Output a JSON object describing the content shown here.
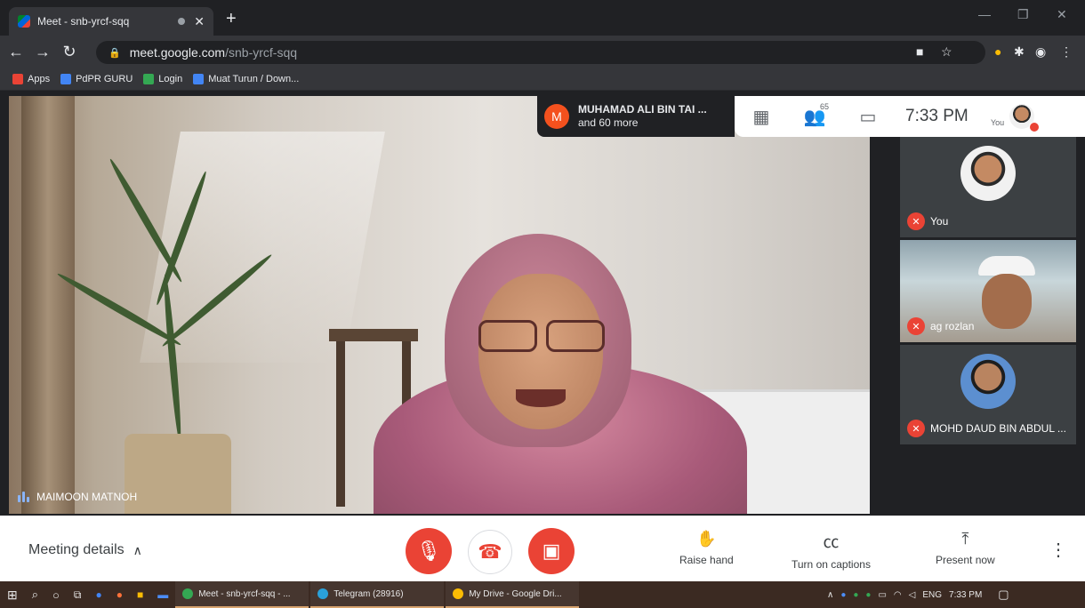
{
  "browser": {
    "tab_title": "Meet - snb-yrcf-sqq",
    "url_host": "meet.google.com",
    "url_path": "/snb-yrcf-sqq",
    "bookmarks": [
      {
        "label": "Apps",
        "color": "#ea4335"
      },
      {
        "label": "PdPR GURU",
        "color": "#4285f4"
      },
      {
        "label": "Login",
        "color": "#34a853"
      },
      {
        "label": "Muat Turun / Down...",
        "color": "#4285f4"
      }
    ]
  },
  "meet": {
    "main_speaker": "MAIMOON MATNOH",
    "presence": {
      "avatar_letter": "M",
      "name": "MUHAMAD ALI BIN TAI ...",
      "subtext": "and 60 more"
    },
    "participants_count": "65",
    "time": "7:33 PM",
    "you_label": "You",
    "tiles": [
      {
        "name": "You"
      },
      {
        "name": "ag rozlan"
      },
      {
        "name": "MOHD DAUD BIN ABDUL ..."
      }
    ],
    "controls": {
      "meeting_details": "Meeting details",
      "raise_hand": "Raise hand",
      "captions": "Turn on captions",
      "present": "Present now"
    },
    "colors": {
      "accent_red": "#ea4335",
      "speaking_blue": "#8ab4f8"
    }
  },
  "taskbar": {
    "apps": [
      {
        "label": "Meet - snb-yrcf-sqq - ...",
        "color": "#34a853"
      },
      {
        "label": "Telegram (28916)",
        "color": "#2aa1da"
      },
      {
        "label": "My Drive - Google Dri...",
        "color": "#fbbc04"
      }
    ],
    "language": "ENG",
    "time": "7:33 PM"
  }
}
